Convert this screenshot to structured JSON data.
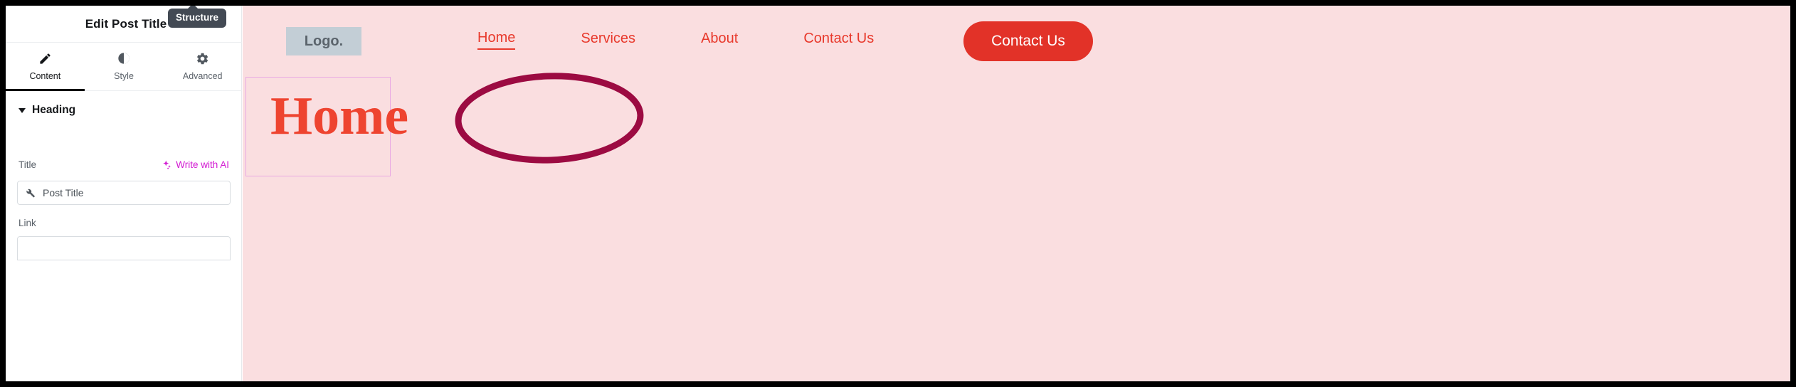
{
  "panel": {
    "title": "Edit Post Title",
    "structure_tooltip": "Structure",
    "tabs": [
      {
        "label": "Content",
        "icon": "pencil-icon",
        "active": true
      },
      {
        "label": "Style",
        "icon": "contrast-icon",
        "active": false
      },
      {
        "label": "Advanced",
        "icon": "gear-icon",
        "active": false
      }
    ],
    "section": {
      "label": "Heading",
      "expanded": true,
      "caret_icon": "caret-down-icon"
    },
    "fields": {
      "title_label": "Title",
      "write_with_ai": "Write with AI",
      "write_with_ai_icon": "sparkle-icon",
      "title_input_value": "Post Title",
      "title_input_icon": "wrench-icon",
      "link_label": "Link",
      "link_input_value": ""
    }
  },
  "preview": {
    "logo_text": "Logo.",
    "nav_links": [
      {
        "label": "Home",
        "active": true
      },
      {
        "label": "Services",
        "active": false
      },
      {
        "label": "About",
        "active": false
      },
      {
        "label": "Contact Us",
        "active": false
      }
    ],
    "cta_button": "Contact Us",
    "page_heading": "Home"
  },
  "colors": {
    "accent_red": "#e8392c",
    "button_red": "#e23228",
    "heading_red": "#ee4430",
    "preview_background": "#fadee0",
    "annotation_crimson": "#9c0b42",
    "ai_magenta": "#d219d2",
    "logo_gray": "#c3ced6",
    "tooltip_dark": "#434a54"
  }
}
